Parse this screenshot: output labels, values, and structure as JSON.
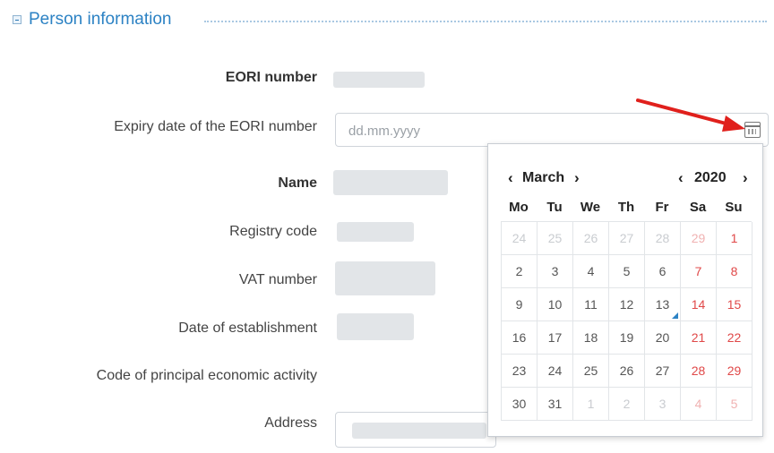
{
  "section": {
    "title": "Person information"
  },
  "fields": {
    "eori_label": "EORI number",
    "expiry_label": "Expiry date of the EORI number",
    "expiry_placeholder": "dd.mm.yyyy",
    "name_label": "Name",
    "registry_label": "Registry code",
    "vat_label": "VAT number",
    "establishment_label": "Date of establishment",
    "activity_label": "Code of principal economic activity",
    "address_label": "Address"
  },
  "calendar": {
    "prev_month": "‹",
    "month": "March",
    "next_month": "›",
    "prev_year": "‹",
    "year": "2020",
    "next_year": "›",
    "weekdays": [
      "Mo",
      "Tu",
      "We",
      "Th",
      "Fr",
      "Sa",
      "Su"
    ],
    "weeks": [
      [
        "24",
        "25",
        "26",
        "27",
        "28",
        "29",
        "1"
      ],
      [
        "2",
        "3",
        "4",
        "5",
        "6",
        "7",
        "8"
      ],
      [
        "9",
        "10",
        "11",
        "12",
        "13",
        "14",
        "15"
      ],
      [
        "16",
        "17",
        "18",
        "19",
        "20",
        "21",
        "22"
      ],
      [
        "23",
        "24",
        "25",
        "26",
        "27",
        "28",
        "29"
      ],
      [
        "30",
        "31",
        "1",
        "2",
        "3",
        "4",
        "5"
      ]
    ],
    "today": "13",
    "weekend_color": "#e04848",
    "accent_color": "#2c82c4"
  }
}
